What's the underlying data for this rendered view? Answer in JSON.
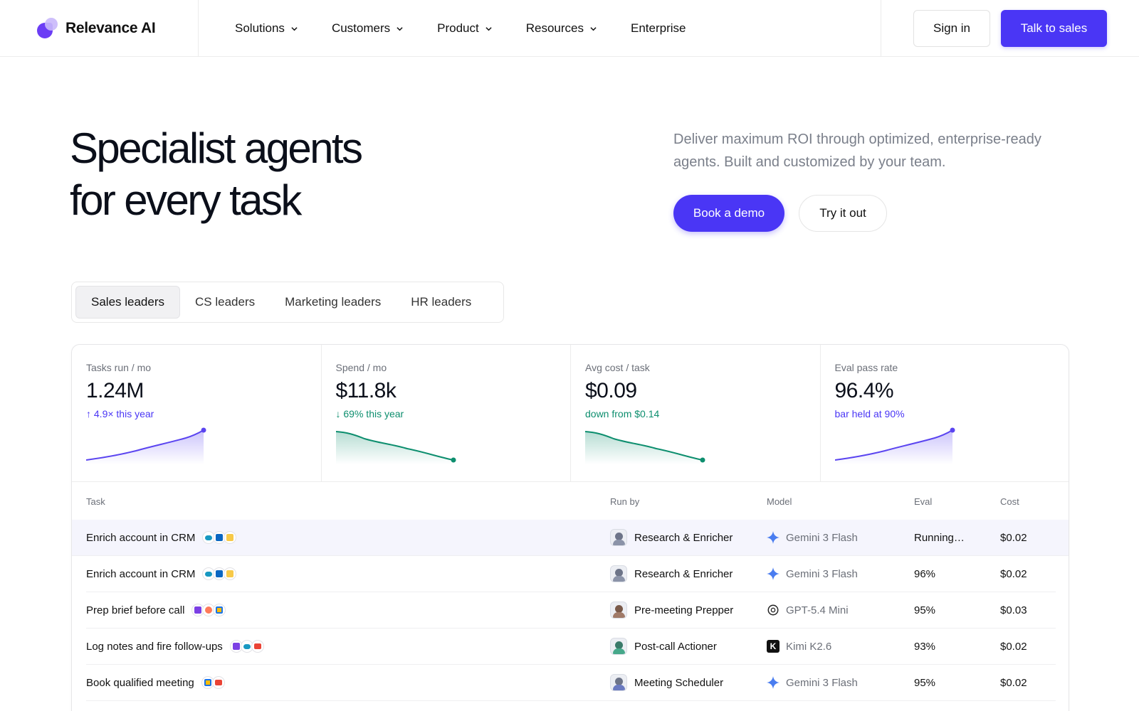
{
  "brand": {
    "name": "Relevance AI"
  },
  "nav": {
    "items": [
      {
        "label": "Solutions",
        "has_menu": true
      },
      {
        "label": "Customers",
        "has_menu": true
      },
      {
        "label": "Product",
        "has_menu": true
      },
      {
        "label": "Resources",
        "has_menu": true
      },
      {
        "label": "Enterprise",
        "has_menu": false
      }
    ],
    "sign_in": "Sign in",
    "talk_to_sales": "Talk to sales"
  },
  "hero": {
    "title_line1": "Specialist agents",
    "title_line2": "for every task",
    "subtitle": "Deliver maximum ROI through optimized, enterprise-ready agents. Built and customized by your team.",
    "book_demo": "Book a demo",
    "try_it": "Try it out"
  },
  "tabs": [
    {
      "label": "Sales leaders",
      "active": true
    },
    {
      "label": "CS leaders",
      "active": false
    },
    {
      "label": "Marketing leaders",
      "active": false
    },
    {
      "label": "HR leaders",
      "active": false
    }
  ],
  "stats": [
    {
      "label": "Tasks run / mo",
      "value": "1.24M",
      "delta": "↑ 4.9× this year",
      "tone": "purple",
      "trend": "up"
    },
    {
      "label": "Spend / mo",
      "value": "$11.8k",
      "delta": "↓ 69% this year",
      "tone": "green",
      "trend": "down"
    },
    {
      "label": "Avg cost / task",
      "value": "$0.09",
      "delta": "down from $0.14",
      "tone": "green",
      "trend": "down"
    },
    {
      "label": "Eval pass rate",
      "value": "96.4%",
      "delta": "bar held at 90%",
      "tone": "purple",
      "trend": "up"
    }
  ],
  "table": {
    "headers": {
      "task": "Task",
      "run_by": "Run by",
      "model": "Model",
      "eval": "Eval",
      "cost": "Cost"
    },
    "rows": [
      {
        "task": "Enrich account in CRM",
        "run_by": "Research & Enricher",
        "model": "Gemini 3 Flash",
        "eval": "Running…",
        "cost": "$0.02",
        "highlight": true
      },
      {
        "task": "Enrich account in CRM",
        "run_by": "Research & Enricher",
        "model": "Gemini 3 Flash",
        "eval": "96%",
        "cost": "$0.02"
      },
      {
        "task": "Prep brief before call",
        "run_by": "Pre-meeting Prepper",
        "model": "GPT-5.4 Mini",
        "eval": "95%",
        "cost": "$0.03"
      },
      {
        "task": "Log notes and fire follow-ups",
        "run_by": "Post-call Actioner",
        "model": "Kimi K2.6",
        "eval": "93%",
        "cost": "$0.02"
      },
      {
        "task": "Book qualified meeting",
        "run_by": "Meeting Scheduler",
        "model": "Gemini 3 Flash",
        "eval": "95%",
        "cost": "$0.02"
      }
    ]
  },
  "colors": {
    "accent": "#4a36f5",
    "positive": "#0d8e6e"
  }
}
